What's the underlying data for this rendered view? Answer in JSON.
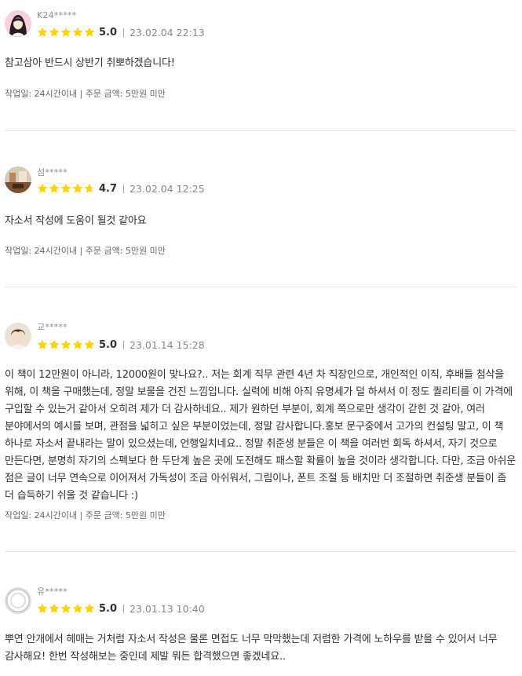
{
  "reviews": [
    {
      "username": "K24*****",
      "avatar": "girl-portrait-avatar",
      "rating": 5.0,
      "score_label": "5.0",
      "date": "23.02.04 22:13",
      "text": "참고삼아 반드시 상반기 취뽀하겠습니다!",
      "meta": "작업일: 24시간이내 | 주문 금액: 5만원 미만"
    },
    {
      "username": "섬*****",
      "avatar": "room-photo-avatar",
      "rating": 4.7,
      "score_label": "4.7",
      "date": "23.02.04 12:25",
      "text": "자소서 작성에 도움이 될것 같아요",
      "meta": "작업일: 24시간이내 | 주문 금액: 5만원 미만"
    },
    {
      "username": "교*****",
      "avatar": "boy-portrait-avatar",
      "rating": 5.0,
      "score_label": "5.0",
      "date": "23.01.14 15:28",
      "text": "이 책이 12만원이 아니라, 12000원이 맞나요?.. 저는 회계 직무 관련 4년 차 직장인으로, 개인적인 이직, 후배들 첨삭을 위해, 이 책을 구매했는데, 정말 보물을 건진 느낌입니다. 실력에 비해 아직 유명세가 덜 하셔서 이 정도 퀄리티를 이 가격에 구입할 수 있는거 같아서 오히려 제가 더 감사하네요.. 제가 원하던 부분이, 회계 쪽으로만 생각이 갇힌 것 같아, 여러 분야에서의 예시를 보며, 관점을 넓히고 싶은 부분이었는데, 정말 감사합니다.홍보 문구중에서 고가의 컨설팅 말고, 이 책 하나로 자소서 끝내라는 말이 있으셨는데, 언행일치네요.. 정말 취준생 분들은 이 책을 여러번 회독 하셔서, 자기 것으로 만든다면, 분명히 자기의 스펙보다 한 두단계 높은 곳에 도전해도 패스할 확률이 높을 것이라 생각합니다.  다만, 조금 아쉬운 점은 글이 너무 연속으로 이어져서 가독성이 조금 아쉬워서, 그림이나, 폰트 조절 등 배치만 더 조절하면 취준생 분들이 좀 더 습득하기 쉬울 것 같습니다 :)",
      "meta": "작업일: 24시간이내 | 주문 금액: 5만원 미만"
    },
    {
      "username": "유*****",
      "avatar": "default-user-avatar",
      "rating": 5.0,
      "score_label": "5.0",
      "date": "23.01.13 10:40",
      "text": "뿌연 안개에서 헤매는 거처럼 자소서 작성은 물론 면접도 너무 막막했는데 저렴한 가격에 노하우를 받을 수 있어서 너무 감사해요! 한번 작성해보는 중인데 제발 뭐든 합격했으면 좋겠네요..",
      "meta": ""
    }
  ],
  "colors": {
    "star": "#ffd400",
    "star_empty": "#e3e3e3",
    "text": "#303030",
    "muted": "#888888"
  }
}
